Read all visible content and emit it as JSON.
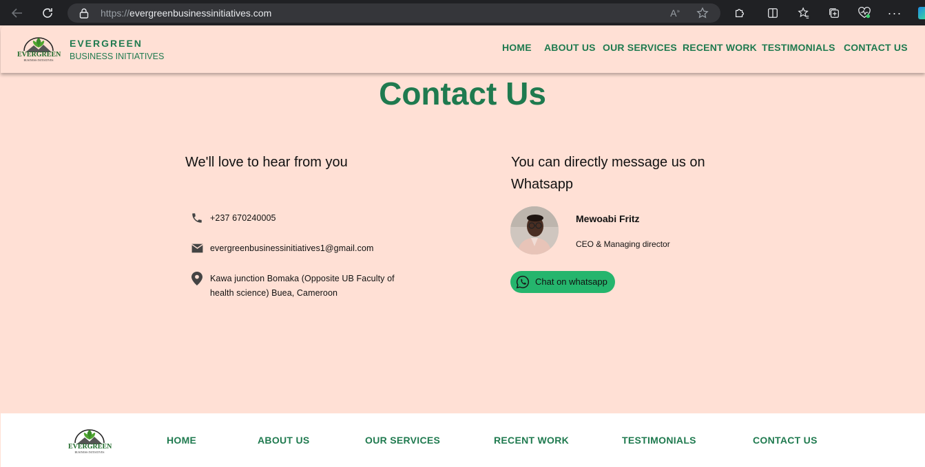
{
  "browser": {
    "url_protocol": "https://",
    "url_host": "evergreenbusinessinitiatives.com"
  },
  "header": {
    "logo_text": "EVERGREEN",
    "logo_subtext": "BUSINESS INITIATIVES",
    "brand_name": "EVERGREEN",
    "brand_sub": "BUSINESS INITIATIVES",
    "nav": [
      "HOME",
      "ABOUT US",
      "OUR SERVICES",
      "RECENT WORK",
      "TESTIMONIALS",
      "CONTACT US"
    ]
  },
  "main": {
    "title": "Contact Us",
    "left_heading": "We'll love to hear from you",
    "phone": "+237 670240005",
    "email": "evergreenbusinessinitiatives1@gmail.com",
    "address_line1": "Kawa junction Bomaka (Opposite UB Faculty of",
    "address_line2": "health science) Buea, Cameroon",
    "right_heading_line1": "You can directly message us on",
    "right_heading_line2": "Whatsapp",
    "person_name": "Mewoabi Fritz",
    "person_role": "CEO & Managing director",
    "whatsapp_label": "Chat on whatsapp"
  },
  "footer": {
    "logo_text": "EVERGREEN",
    "logo_subtext": "BUSINESS INITIATIVES",
    "nav": [
      "HOME",
      "ABOUT US",
      "OUR SERVICES",
      "RECENT WORK",
      "TESTIMONIALS",
      "CONTACT US"
    ]
  },
  "colors": {
    "brand_green": "#1f7a4f",
    "page_bg": "#ffe0d5",
    "whatsapp_green": "#25b56d"
  }
}
